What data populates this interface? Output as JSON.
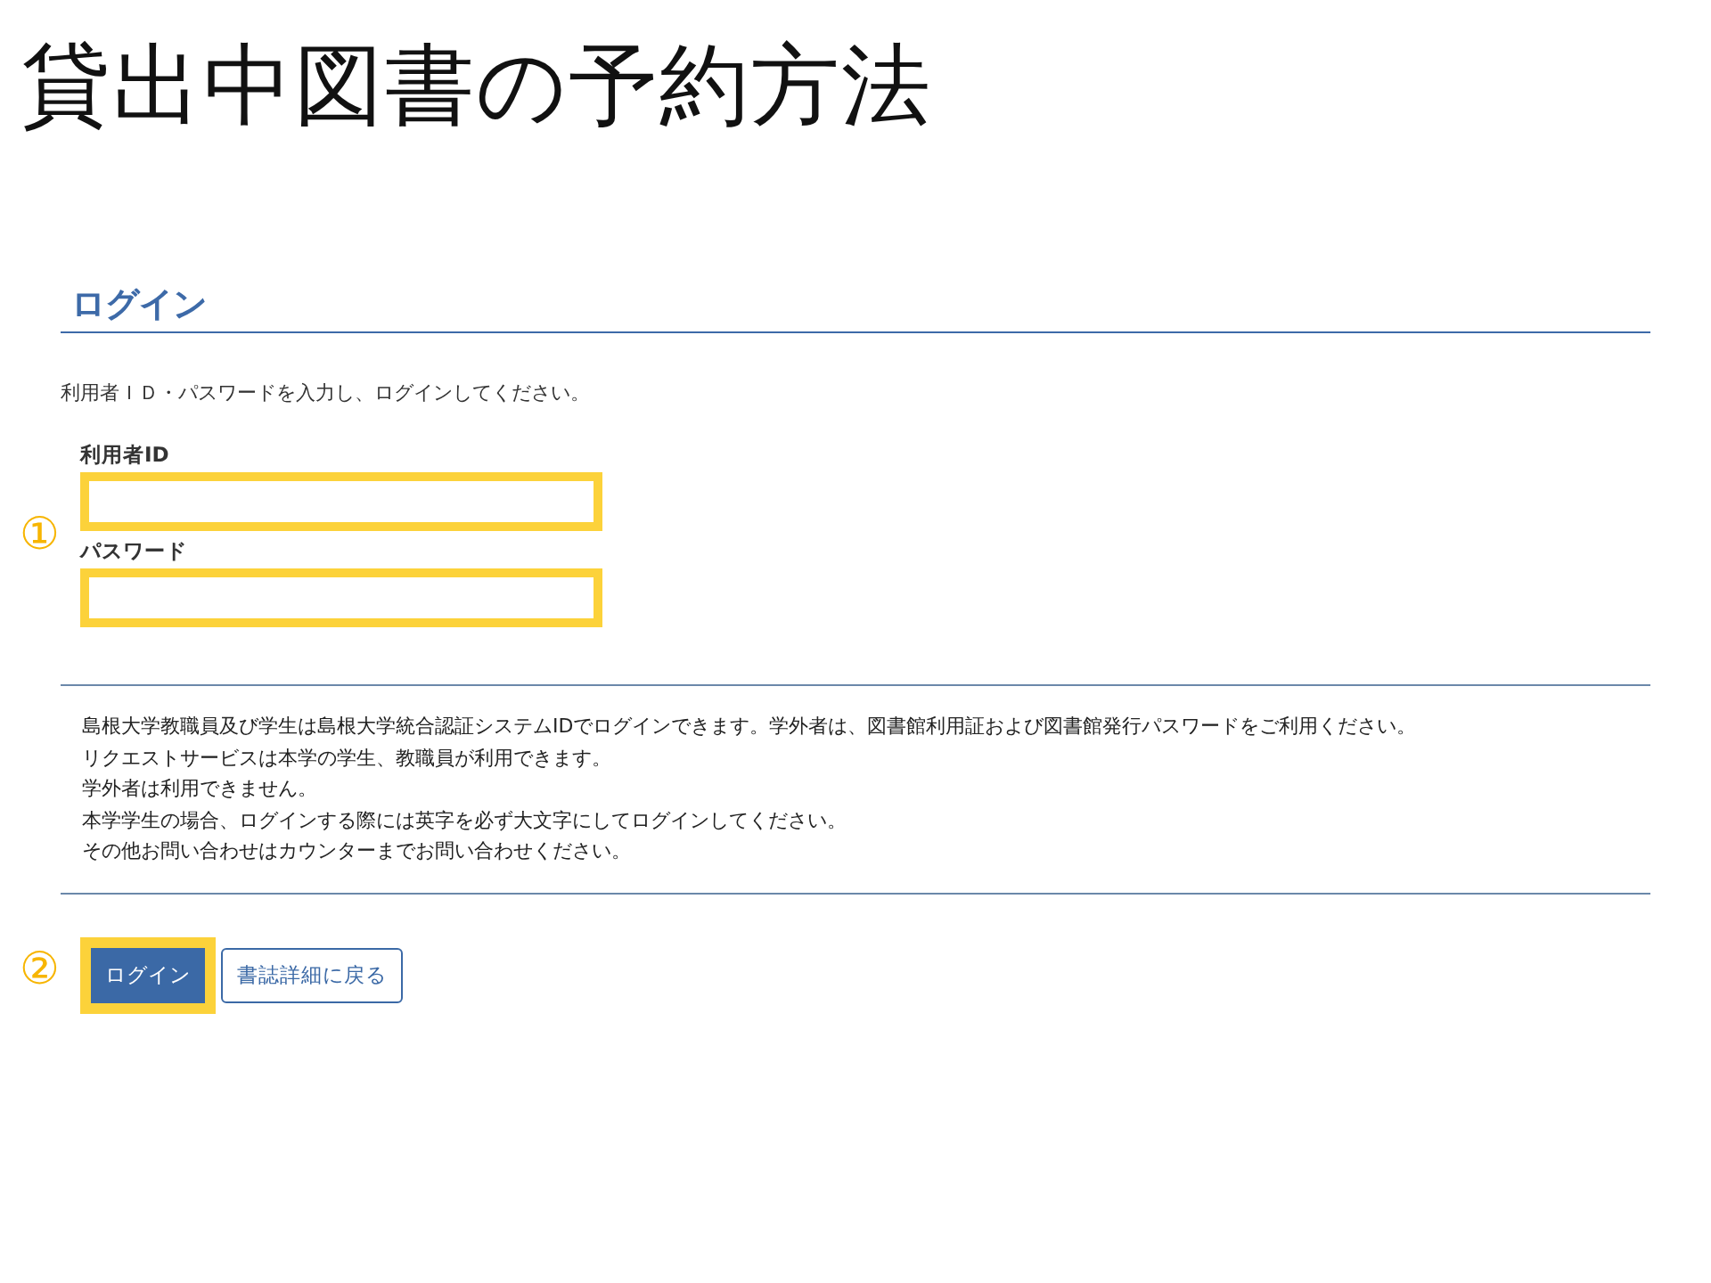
{
  "slide_title": "貸出中図書の予約方法",
  "login": {
    "heading": "ログイン",
    "instruction": "利用者ＩＤ・パスワードを入力し、ログインしてください。",
    "step_marker": "①",
    "fields": [
      {
        "label": "利用者ID",
        "highlighted": true
      },
      {
        "label": "パスワード",
        "highlighted": true
      }
    ],
    "notice": [
      "島根大学教職員及び学生は島根大学統合認証システムIDでログインできます。学外者は、図書館利用証および図書館発行パスワードをご利用ください。",
      "リクエストサービスは本学の学生、教職員が利用できます。",
      "学外者は利用できません。",
      "本学学生の場合、ログインする際には英字を必ず大文字にしてログインしてください。",
      "その他お問い合わせはカウンターまでお問い合わせください。"
    ],
    "buttons_step_marker": "②",
    "buttons": [
      {
        "label": "ログイン",
        "kind": "primary",
        "highlighted": true
      },
      {
        "label": "書誌詳細に戻る",
        "kind": "secondary",
        "highlighted": false
      }
    ]
  }
}
